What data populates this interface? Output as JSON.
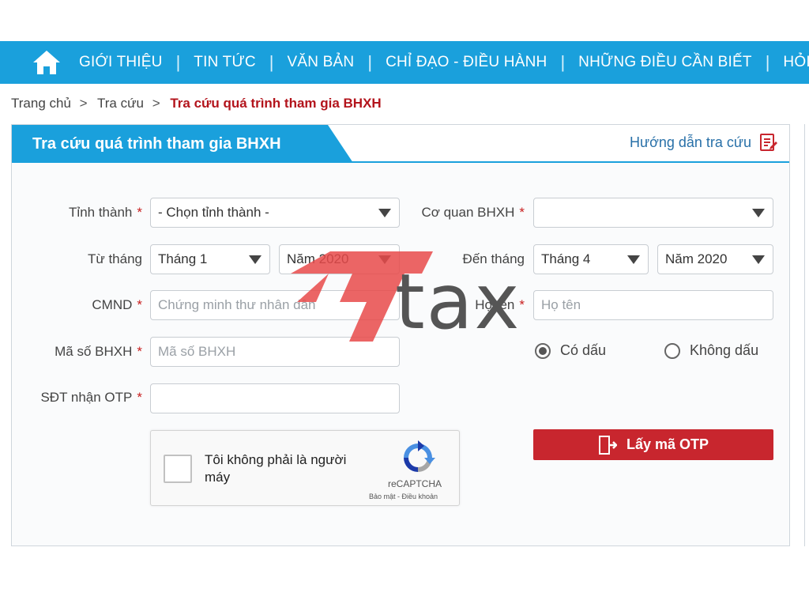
{
  "nav": {
    "items": [
      "GIỚI THIỆU",
      "TIN TỨC",
      "VĂN BẢN",
      "CHỈ ĐẠO - ĐIỀU HÀNH",
      "NHỮNG ĐIỀU CẦN BIẾT",
      "HỎI -"
    ],
    "separator": "|"
  },
  "breadcrumb": {
    "home": "Trang chủ",
    "lookup": "Tra cứu",
    "current": "Tra cứu quá trình tham gia BHXH",
    "separator": ">"
  },
  "panel": {
    "title": "Tra cứu quá trình tham gia BHXH",
    "help_label": "Hướng dẫn tra cứu"
  },
  "form": {
    "province_label": "Tỉnh thành",
    "province_value": "- Chọn tỉnh thành -",
    "agency_label": "Cơ quan BHXH",
    "agency_value": "",
    "from_label": "Từ tháng",
    "from_month": "Tháng 1",
    "from_year": "Năm 2020",
    "to_label": "Đến tháng",
    "to_month": "Tháng 4",
    "to_year": "Năm 2020",
    "id_label": "CMND",
    "id_placeholder": "Chứng minh thư nhân dân",
    "name_label": "Họ tên",
    "name_placeholder": "Họ tên",
    "bhxh_label": "Mã số BHXH",
    "bhxh_placeholder": "Mã số BHXH",
    "phone_label": "SĐT nhận OTP",
    "phone_value": "",
    "required_mark": "*",
    "accent_option": "Có dấu",
    "no_accent_option": "Không dấu",
    "selected_option": "Có dấu"
  },
  "captcha": {
    "text": "Tôi không phải là người máy",
    "brand": "reCAPTCHA",
    "terms": "Bảo mật - Điều khoản"
  },
  "otp_button": {
    "label": "Lấy mã OTP"
  },
  "watermark": {
    "text": "tax"
  },
  "colors": {
    "nav_bg": "#1aa0dc",
    "breadcrumb_current": "#b3141c",
    "required": "#c81e1e",
    "otp_bg": "#c8262e",
    "help_link": "#2870a8"
  },
  "icons": {
    "home": "home-icon",
    "help": "edit-document-icon",
    "otp": "door-exit-icon",
    "captcha": "recaptcha-logo-icon"
  }
}
